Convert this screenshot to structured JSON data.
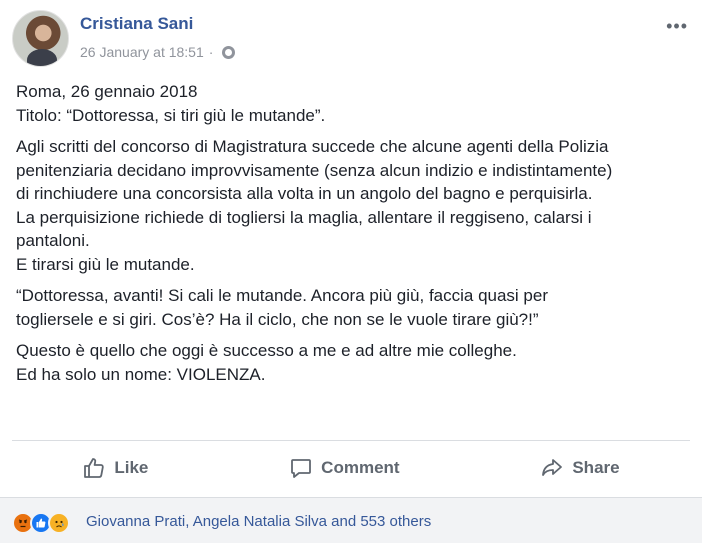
{
  "post": {
    "author": "Cristiana Sani",
    "timestamp": "26 January at 18:51",
    "privacy_icon": "globe-icon",
    "more_icon": "ellipsis-icon",
    "more_glyph": "•••",
    "paragraphs": [
      [
        "Roma, 26 gennaio 2018",
        "Titolo: “Dottoressa, si tiri giù le mutande”."
      ],
      [
        "Agli scritti del concorso di Magistratura succede che alcune agenti della Polizia",
        "penitenziaria decidano improvvisamente (senza alcun indizio e indistintamente)",
        "di rinchiudere una concorsista alla volta in un angolo del bagno e perquisirla.",
        "La perquisizione richiede di togliersi la maglia, allentare il reggiseno, calarsi i",
        "pantaloni.",
        "E tirarsi giù le mutande."
      ],
      [
        "“Dottoressa, avanti! Si cali le mutande. Ancora più giù, faccia quasi per",
        "togliersele e si giri. Cos’è? Ha il ciclo, che non se le vuole tirare giù?!”"
      ],
      [
        "Questo è quello che oggi è successo a me e ad altre mie colleghe.",
        "Ed ha solo un nome: VIOLENZA."
      ]
    ]
  },
  "actions": {
    "like_label": "Like",
    "comment_label": "Comment",
    "share_label": "Share"
  },
  "reactions": {
    "icons": [
      "angry-reaction-icon",
      "like-reaction-icon",
      "sad-reaction-icon"
    ],
    "summary": "Giovanna Prati, Angela Natalia Silva and 553 others"
  },
  "colors": {
    "author_link": "#365899",
    "meta_text": "#90949c",
    "action_text": "#606770",
    "footer_bg": "#f2f3f5",
    "like_blue": "#1877f2",
    "angry_orange": "#e9710f",
    "sad_yellow": "#f7b125"
  }
}
